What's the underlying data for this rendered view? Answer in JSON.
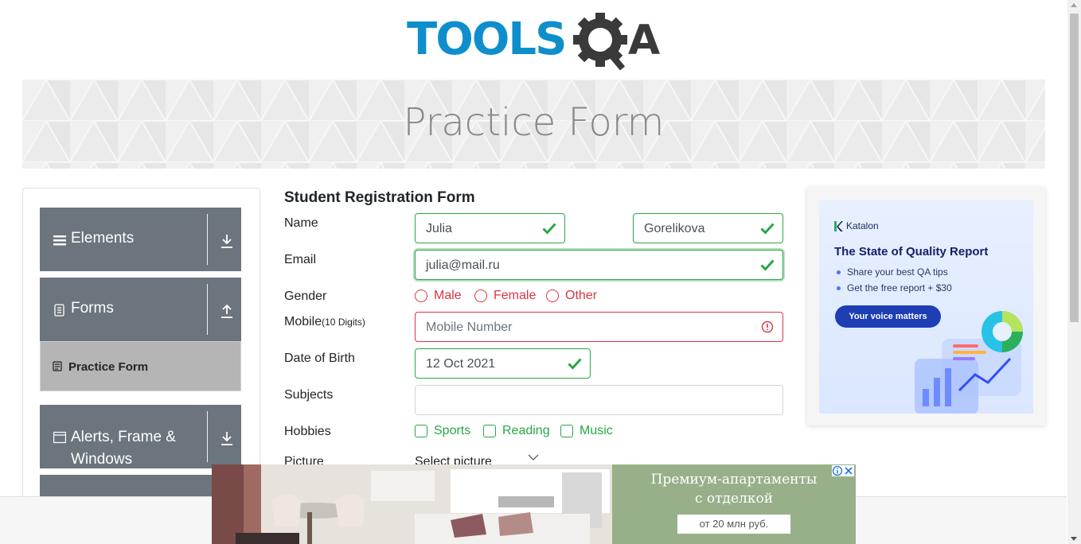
{
  "logo": {
    "text_tools": "TOOLS",
    "text_qa": "QA"
  },
  "banner": {
    "title": "Practice Form"
  },
  "sidebar": {
    "groups": [
      {
        "label": "Elements",
        "icon": "hamburger-icon",
        "arrow": "download-arrow-icon"
      },
      {
        "label": "Forms",
        "icon": "document-icon",
        "arrow": "upload-arrow-icon"
      },
      {
        "label": "Alerts, Frame & Windows",
        "icon": "window-icon",
        "arrow": "download-arrow-icon"
      }
    ],
    "active_item": {
      "label": "Practice Form",
      "icon": "form-icon"
    }
  },
  "form": {
    "title": "Student Registration Form",
    "name_label": "Name",
    "first_name": "Julia",
    "last_name": "Gorelikova",
    "email_label": "Email",
    "email": "julia@mail.ru",
    "gender_label": "Gender",
    "genders": [
      "Male",
      "Female",
      "Other"
    ],
    "mobile_label": "Mobile",
    "mobile_hint": "(10 Digits)",
    "mobile_placeholder": "Mobile Number",
    "dob_label": "Date of Birth",
    "dob": "12 Oct 2021",
    "subjects_label": "Subjects",
    "subjects": "",
    "hobbies_label": "Hobbies",
    "hobbies": [
      "Sports",
      "Reading",
      "Music"
    ],
    "picture_label": "Picture",
    "picture_button": "Select picture"
  },
  "ad_right": {
    "brand": "Katalon",
    "title": "The State of Quality Report",
    "bullets": [
      "Share your best QA tips",
      "Get the free report + $30"
    ],
    "button": "Your voice matters"
  },
  "ad_bottom": {
    "headline_1": "Премиум-апартаменты",
    "headline_2": "с отделкой",
    "price": "от 20 млн руб."
  },
  "colors": {
    "valid": "#28a745",
    "invalid": "#dc3545",
    "sidebar": "#6c757d",
    "logo_blue": "#0e8fcc",
    "logo_dark": "#3a3a3a"
  }
}
